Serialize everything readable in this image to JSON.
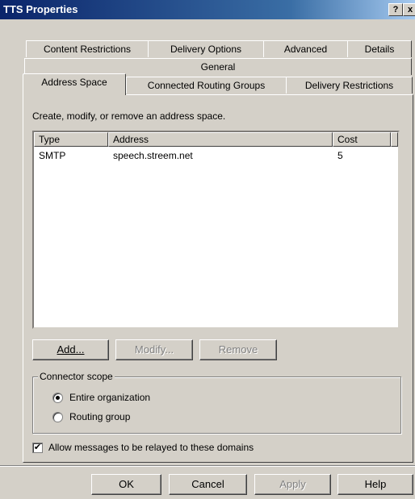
{
  "window": {
    "title": "TTS Properties",
    "help_btn": "?",
    "close_btn": "x"
  },
  "tabs": {
    "row1": [
      "Content Restrictions",
      "Delivery Options",
      "Advanced",
      "Details"
    ],
    "row2": [
      "General"
    ],
    "row3": [
      "Address Space",
      "Connected Routing Groups",
      "Delivery Restrictions"
    ]
  },
  "panel": {
    "instruction": "Create, modify, or remove an address space.",
    "list": {
      "columns": [
        "Type",
        "Address",
        "Cost"
      ],
      "rows": [
        {
          "type": "SMTP",
          "address": "speech.streem.net",
          "cost": "5"
        }
      ]
    },
    "buttons": {
      "add": "Add...",
      "modify": "Modify...",
      "remove": "Remove"
    },
    "scope": {
      "legend": "Connector scope",
      "options": [
        "Entire organization",
        "Routing group"
      ],
      "selected": "Entire organization"
    },
    "relay_checkbox": {
      "label": "Allow messages to be relayed to these domains",
      "checked": true
    }
  },
  "footer": {
    "ok": "OK",
    "cancel": "Cancel",
    "apply": "Apply",
    "help": "Help"
  }
}
